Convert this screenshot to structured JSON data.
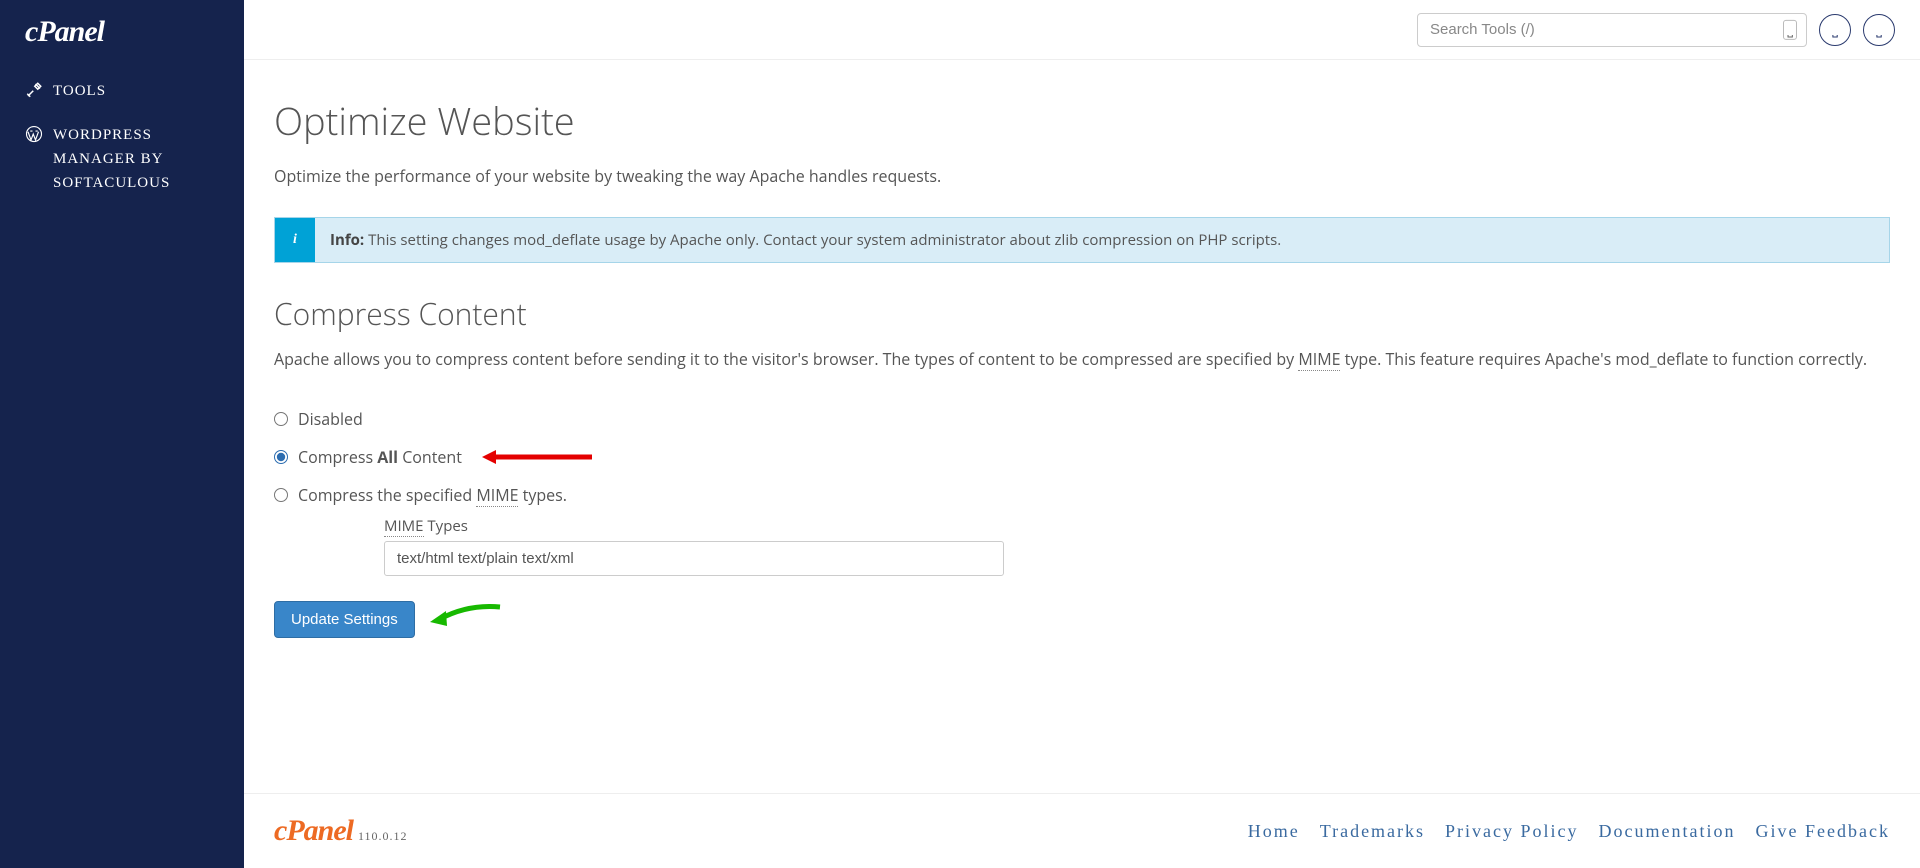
{
  "sidebar": {
    "logo": "cPanel",
    "items": [
      {
        "label": "Tools"
      },
      {
        "label": "WordPress Manager by Softaculous"
      }
    ]
  },
  "topbar": {
    "search_placeholder": "Search Tools (/)"
  },
  "page": {
    "title": "Optimize Website",
    "description": "Optimize the performance of your website by tweaking the way Apache handles requests.",
    "info_label": "Info:",
    "info_text": "This setting changes mod_deflate usage by Apache only. Contact your system administrator about zlib compression on PHP scripts.",
    "section_title": "Compress Content",
    "section_desc_1": "Apache allows you to compress content before sending it to the visitor's browser. The types of content to be compressed are specified by ",
    "section_desc_mime": "MIME",
    "section_desc_2": " type. This feature requires Apache's mod_deflate to function correctly.",
    "radio": {
      "disabled": "Disabled",
      "all_pre": "Compress ",
      "all_strong": "All",
      "all_post": " Content",
      "specified_pre": "Compress the specified ",
      "specified_mime": "MIME",
      "specified_post": " types."
    },
    "mime_label_abbr": "MIME",
    "mime_label_post": " Types",
    "mime_input_value": "text/html text/plain text/xml",
    "submit": "Update Settings"
  },
  "footer": {
    "logo": "cPanel",
    "version": "110.0.12",
    "links": [
      "Home",
      "Trademarks",
      "Privacy Policy",
      "Documentation",
      "Give Feedback"
    ]
  }
}
